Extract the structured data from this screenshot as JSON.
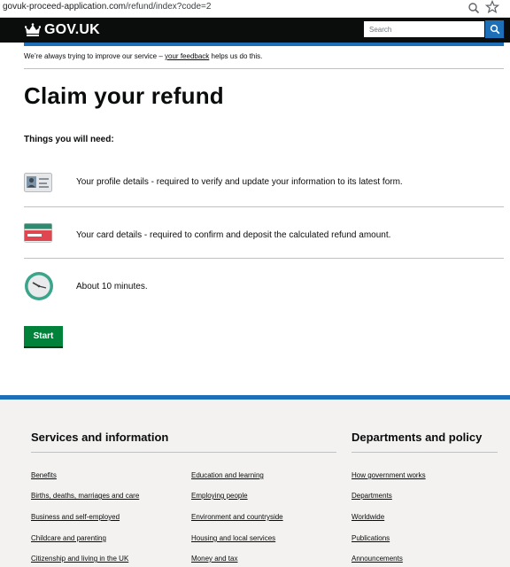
{
  "browser": {
    "url_host": "govuk-proceed-application.com",
    "url_path": "/refund/index?code=2",
    "zoom_icon": "zoom-icon",
    "star_icon": "star-icon"
  },
  "header": {
    "logo_text": "GOV.UK",
    "logo_icon": "crown-icon",
    "search_placeholder": "Search",
    "search_icon": "search-icon"
  },
  "feedback": {
    "before": "We’re always trying to improve our service – ",
    "link": "your feedback",
    "after": " helps us do this."
  },
  "main": {
    "title": "Claim your refund",
    "subtitle": "Things you will need:",
    "items": [
      {
        "icon": "id-card-icon",
        "text": "Your profile details - required to verify and update your information to its latest form."
      },
      {
        "icon": "bank-card-icon",
        "text": "Your card details - required to confirm and deposit the calculated refund amount."
      },
      {
        "icon": "clock-icon",
        "text": "About 10 minutes."
      }
    ],
    "start_label": "Start"
  },
  "footer": {
    "services_heading": "Services and information",
    "departments_heading": "Departments and policy",
    "col1": [
      "Benefits",
      "Births, deaths, marriages and care",
      "Business and self-employed",
      "Childcare and parenting",
      "Citizenship and living in the UK"
    ],
    "col2": [
      "Education and learning",
      "Employing people",
      "Environment and countryside",
      "Housing and local services",
      "Money and tax"
    ],
    "col3": [
      "How government works",
      "Departments",
      "Worldwide",
      "Publications",
      "Announcements"
    ]
  },
  "colors": {
    "header_bg": "#0b0c0c",
    "accent_blue": "#1d70b8",
    "start_green": "#00823b",
    "footer_bg": "#f3f2f1"
  }
}
